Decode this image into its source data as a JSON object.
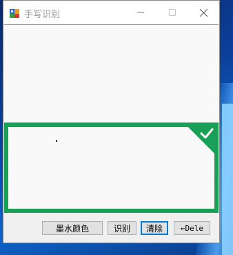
{
  "window": {
    "title": "手写识别"
  },
  "titlebar": {
    "minimize_icon": "minimize-icon",
    "maximize_icon": "maximize-icon",
    "close_icon": "close-icon"
  },
  "canvas": {
    "badge_icon": "checkmark-icon",
    "border_color": "#1aa056"
  },
  "buttons": {
    "ink_color": "墨水颜色",
    "recognize": "识别",
    "clear": "清除",
    "delete": "←Dele"
  },
  "colors": {
    "accent": "#1aa056",
    "focus": "#0078d7"
  }
}
